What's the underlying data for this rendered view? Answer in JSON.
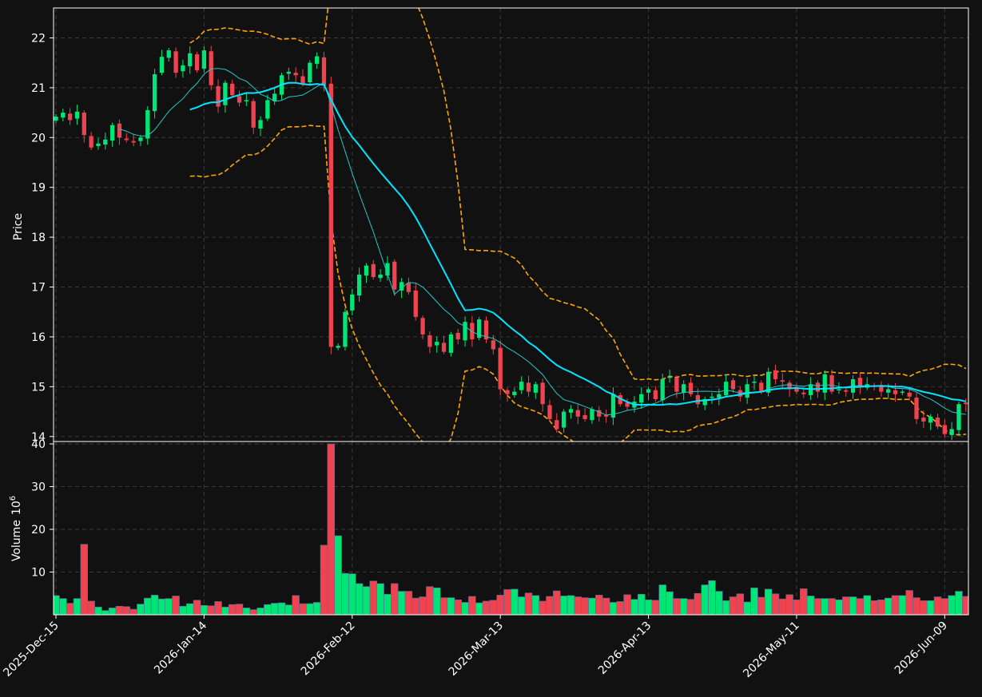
{
  "chart_data": {
    "type": "candlestick",
    "panels": {
      "price": {
        "ylabel": "Price",
        "ylim": [
          13.9,
          22.6
        ],
        "yticks": [
          14,
          15,
          16,
          17,
          18,
          19,
          20,
          21,
          22
        ]
      },
      "volume": {
        "ylabel": "Volume",
        "ylabel_exp": "10",
        "ylabel_sup": "6",
        "ylim": [
          0,
          40
        ],
        "yticks": [
          10,
          20,
          30,
          40
        ]
      }
    },
    "xticks": [
      {
        "index": 0,
        "label": "2025-Dec-15"
      },
      {
        "index": 21,
        "label": "2026-Jan-14"
      },
      {
        "index": 42,
        "label": "2026-Feb-12"
      },
      {
        "index": 63,
        "label": "2026-Mar-13"
      },
      {
        "index": 84,
        "label": "2026-Apr-13"
      },
      {
        "index": 105,
        "label": "2026-May-11"
      },
      {
        "index": 126,
        "label": "2026-Jun-09"
      }
    ],
    "num_bars": 130,
    "grid": true,
    "colors": {
      "background": "#111111",
      "up": "#00e676",
      "down": "#ef4350",
      "ma_fast": "#22c8c8",
      "ma_slow": "#00e5ff",
      "bands": "#ffa500",
      "grid": "#3a3a3a",
      "axes": "#ffffff"
    },
    "close": [
      20.42,
      20.5,
      20.35,
      20.52,
      20.05,
      19.8,
      19.88,
      19.96,
      20.25,
      20.0,
      19.95,
      19.9,
      20.0,
      20.55,
      21.27,
      21.62,
      21.75,
      21.3,
      21.45,
      21.69,
      21.35,
      21.75,
      21.05,
      20.62,
      21.1,
      20.85,
      20.7,
      20.75,
      20.2,
      20.35,
      20.75,
      20.88,
      21.25,
      21.32,
      21.25,
      21.08,
      21.5,
      21.63,
      21.05,
      15.8,
      15.82,
      16.5,
      16.85,
      17.25,
      17.43,
      17.2,
      17.25,
      17.48,
      16.95,
      17.1,
      16.9,
      16.4,
      16.05,
      15.8,
      15.9,
      15.7,
      16.05,
      15.95,
      16.3,
      15.95,
      16.35,
      15.95,
      15.75,
      14.95,
      14.85,
      14.9,
      15.1,
      14.9,
      15.05,
      14.65,
      14.35,
      14.15,
      14.5,
      14.55,
      14.4,
      14.35,
      14.55,
      14.4,
      14.4,
      14.85,
      14.65,
      14.6,
      14.7,
      14.85,
      14.95,
      14.75,
      15.15,
      15.2,
      14.9,
      15.05,
      14.85,
      14.65,
      14.75,
      14.8,
      14.85,
      15.1,
      14.95,
      14.8,
      15.05,
      15.1,
      14.9,
      15.3,
      15.15,
      15.1,
      14.95,
      14.9,
      14.85,
      15.05,
      14.9,
      15.25,
      14.9,
      14.95,
      14.9,
      15.15,
      15.0,
      15.05,
      15.0,
      14.9,
      14.95,
      14.85,
      14.9,
      14.8,
      14.35,
      14.3,
      14.4,
      14.2,
      14.05,
      14.15,
      14.65,
      14.65
    ],
    "volume": [
      4.5,
      3.8,
      2.7,
      3.8,
      16.5,
      3.2,
      1.8,
      1.0,
      1.6,
      2.0,
      1.9,
      1.3,
      2.5,
      3.9,
      4.6,
      3.7,
      3.8,
      4.4,
      2.0,
      2.6,
      3.4,
      2.2,
      2.1,
      3.1,
      1.8,
      2.4,
      2.5,
      1.6,
      1.2,
      1.6,
      2.4,
      2.7,
      2.8,
      2.3,
      4.5,
      2.6,
      2.6,
      2.9,
      16.3,
      40.0,
      18.5,
      9.7,
      9.6,
      7.3,
      6.6,
      7.9,
      7.3,
      4.8,
      7.3,
      5.5,
      5.5,
      3.9,
      4.2,
      6.6,
      6.3,
      4.0,
      4.0,
      3.5,
      2.9,
      4.3,
      2.8,
      3.2,
      3.4,
      4.6,
      5.9,
      6.0,
      4.2,
      5.1,
      4.5,
      3.2,
      4.3,
      5.6,
      4.4,
      4.5,
      4.2,
      4.0,
      3.9,
      4.6,
      3.9,
      2.9,
      3.1,
      4.7,
      3.6,
      4.8,
      3.5,
      3.4,
      7.0,
      5.4,
      3.8,
      3.8,
      3.6,
      5.0,
      7.0,
      8.0,
      5.5,
      3.3,
      4.2,
      4.9,
      3.0,
      6.3,
      4.1,
      6.0,
      4.9,
      3.7,
      4.7,
      3.5,
      6.1,
      4.4,
      3.8,
      3.8,
      3.8,
      3.5,
      4.2,
      4.2,
      3.8,
      4.5,
      3.3,
      3.5,
      3.9,
      4.5,
      4.5,
      5.7,
      4.0,
      3.3,
      3.3,
      4.2,
      3.8,
      4.5,
      5.5,
      4.3
    ]
  }
}
